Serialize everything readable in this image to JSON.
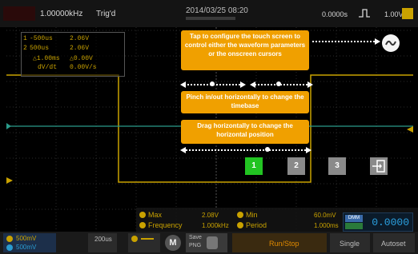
{
  "topbar": {
    "frequency": "1.00000kHz",
    "trigger_status": "Trig'd",
    "datetime": "2014/03/25  08:20",
    "horizontal_position": "0.0000s",
    "trigger_level": "1.00V",
    "trigger_edge_icon": "rising-edge-icon"
  },
  "measure_panel": {
    "rows": [
      {
        "k": "1",
        "name": "-500us",
        "value": "2.06V"
      },
      {
        "k": "2",
        "name": "500us",
        "value": "2.06V"
      },
      {
        "k": "",
        "name": "△1.00ms",
        "value": "△0.00V"
      },
      {
        "k": "",
        "name": "dV/dt",
        "value": "0.00V/s"
      }
    ]
  },
  "tips": {
    "touch": "Tap to configure the touch screen to control either the waveform parameters or the onscreen cursors",
    "pinch": "Pinch in/out horizontally to change the timebase",
    "drag": "Drag horizontally to change the horizontal position"
  },
  "numbered_buttons": [
    "1",
    "2",
    "3"
  ],
  "measurements": {
    "max_label": "Max",
    "max_value": "2.08V",
    "min_label": "Min",
    "min_value": "60.0mV",
    "freq_label": "Frequency",
    "freq_value": "1.000kHz",
    "period_label": "Period",
    "period_value": "1.000ms"
  },
  "dmm": {
    "tag": "DMM",
    "reading": "0.0000"
  },
  "softkeys": {
    "ch1_scale": "500mV",
    "ch2_scale": "500mV",
    "timebase": "200us",
    "math_label": "M",
    "save_label": "Save",
    "save_sub": "PNG",
    "run_stop": "Run/Stop",
    "single": "Single",
    "autoset": "Autoset"
  },
  "colors": {
    "ch1": "#c9a200",
    "ch2": "#2a9b8a",
    "tip": "#f0a000",
    "active_button": "#22c422"
  }
}
